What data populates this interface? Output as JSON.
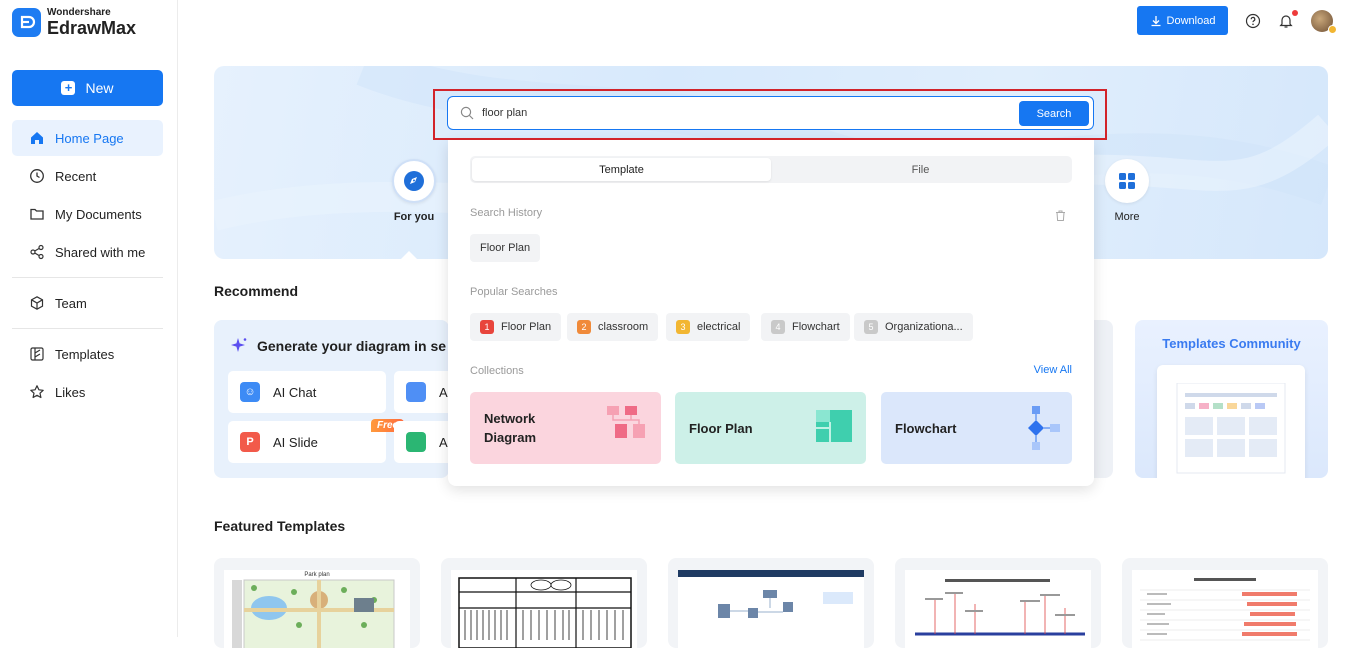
{
  "app": {
    "brand_small": "Wondershare",
    "brand_big": "EdrawMax"
  },
  "sidebar": {
    "new_label": "New",
    "items": [
      {
        "label": "Home Page",
        "icon": "home-icon"
      },
      {
        "label": "Recent",
        "icon": "clock-icon"
      },
      {
        "label": "My Documents",
        "icon": "folder-icon"
      },
      {
        "label": "Shared with me",
        "icon": "share-icon"
      },
      {
        "label": "Team",
        "icon": "cube-icon"
      },
      {
        "label": "Templates",
        "icon": "template-icon"
      },
      {
        "label": "Likes",
        "icon": "star-icon"
      }
    ]
  },
  "topbar": {
    "download_label": "Download"
  },
  "hero": {
    "categories": [
      {
        "label": "For you"
      },
      {
        "label": "More"
      }
    ]
  },
  "search": {
    "value": "floor plan",
    "button_label": "Search",
    "tabs": [
      "Template",
      "File"
    ],
    "history_title": "Search History",
    "history": [
      "Floor Plan"
    ],
    "popular_title": "Popular Searches",
    "popular": [
      {
        "rank": "1",
        "label": "Floor Plan",
        "color": "#e8453c"
      },
      {
        "rank": "2",
        "label": "classroom",
        "color": "#f08a3a"
      },
      {
        "rank": "3",
        "label": "electrical",
        "color": "#f2b632"
      },
      {
        "rank": "4",
        "label": "Flowchart",
        "color": "#c9c9c9"
      },
      {
        "rank": "5",
        "label": "Organizationa...",
        "color": "#c9c9c9"
      }
    ],
    "collections_title": "Collections",
    "view_all": "View All",
    "collections": [
      {
        "label_line1": "Network",
        "label_line2": "Diagram",
        "bg": "#fbd5de"
      },
      {
        "label": "Floor Plan",
        "bg": "#cdf0e8"
      },
      {
        "label": "Flowchart",
        "bg": "#dbe7fb"
      }
    ]
  },
  "recommend": {
    "title": "Recommend",
    "card_title": "Generate your diagram in se",
    "tools": [
      {
        "label": "AI Chat"
      },
      {
        "label": "AI Slide",
        "badge": "Free"
      }
    ],
    "tools_right": [
      "A",
      "A"
    ],
    "community_title": "Templates Community"
  },
  "featured": {
    "title": "Featured Templates",
    "first_template_title": "Park plan"
  },
  "colors": {
    "accent": "#1677f2",
    "highlight": "#d2232a"
  }
}
